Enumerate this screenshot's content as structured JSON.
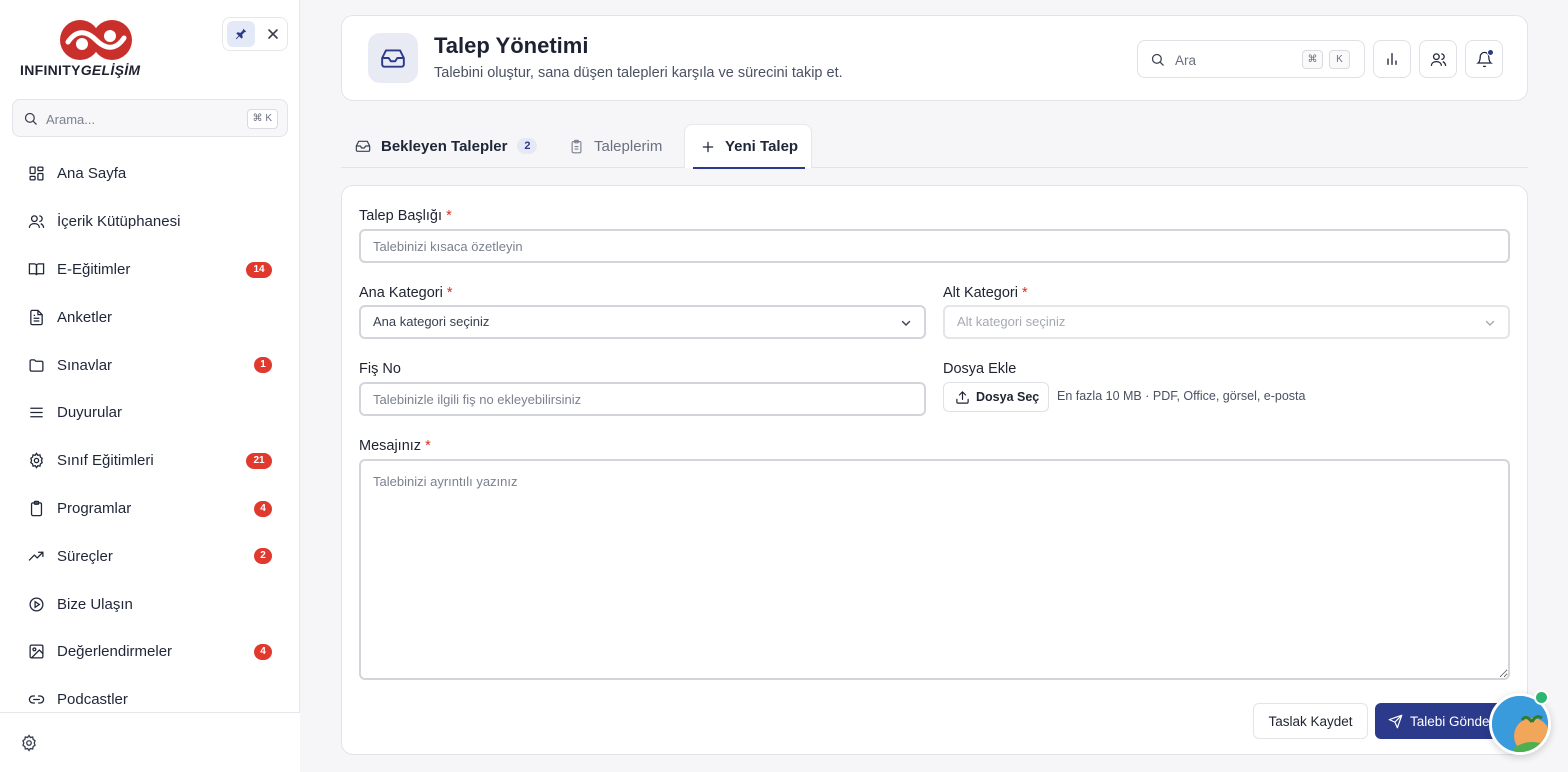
{
  "brand": {
    "logo_line1": "INFINITY",
    "logo_line2": "GELİŞİM",
    "accent_color": "#2c3a8c",
    "logo_color": "#c9302c"
  },
  "sidebar": {
    "search_placeholder": "Arama...",
    "search_shortcut": "⌘ K",
    "items": [
      {
        "label": "Ana Sayfa",
        "icon": "grid-icon",
        "badge": null
      },
      {
        "label": "İçerik Kütüphanesi",
        "icon": "users-icon",
        "badge": null
      },
      {
        "label": "E-Eğitimler",
        "icon": "book-open-icon",
        "badge": "14"
      },
      {
        "label": "Anketler",
        "icon": "file-text-icon",
        "badge": null
      },
      {
        "label": "Sınavlar",
        "icon": "folder-icon",
        "badge": "1"
      },
      {
        "label": "Duyurular",
        "icon": "menu-icon",
        "badge": null
      },
      {
        "label": "Sınıf Eğitimleri",
        "icon": "gear-icon",
        "badge": "21"
      },
      {
        "label": "Programlar",
        "icon": "clipboard-icon",
        "badge": "4"
      },
      {
        "label": "Süreçler",
        "icon": "trending-up-icon",
        "badge": "2"
      },
      {
        "label": "Bize Ulaşın",
        "icon": "play-circle-icon",
        "badge": null
      },
      {
        "label": "Değerlendirmeler",
        "icon": "image-icon",
        "badge": "4"
      },
      {
        "label": "Podcastler",
        "icon": "link-icon",
        "badge": null
      }
    ]
  },
  "header": {
    "title": "Talep Yönetimi",
    "subtitle": "Talebini oluştur, sana düşen talepleri karşıla ve sürecini takip et.",
    "search_placeholder": "Ara",
    "shortcut_key1": "⌘",
    "shortcut_key2": "K"
  },
  "tabs": [
    {
      "label": "Bekleyen Talepler",
      "count": "2",
      "active": false
    },
    {
      "label": "Taleplerim",
      "active": false
    },
    {
      "label": "Yeni Talep",
      "active": true
    }
  ],
  "form": {
    "required_mark": "*",
    "title_label": "Talep Başlığı",
    "title_placeholder": "Talebinizi kısaca özetleyin",
    "category_label": "Ana Kategori",
    "category_value": "Ana kategori seçiniz",
    "subcategory_label": "Alt Kategori",
    "subcategory_value": "Alt kategori seçiniz",
    "receipt_label": "Fiş No",
    "receipt_placeholder": "Talebinizle ilgili fiş no ekleyebilirsiniz",
    "file_label": "Dosya Ekle",
    "file_button": "Dosya Seç",
    "file_hint": "En fazla 10 MB · PDF, Office, görsel, e-posta",
    "message_label": "Mesajınız",
    "message_placeholder": "Talebinizi ayrıntılı yazınız",
    "draft_button": "Taslak Kaydet",
    "submit_button": "Talebi Gönder"
  }
}
